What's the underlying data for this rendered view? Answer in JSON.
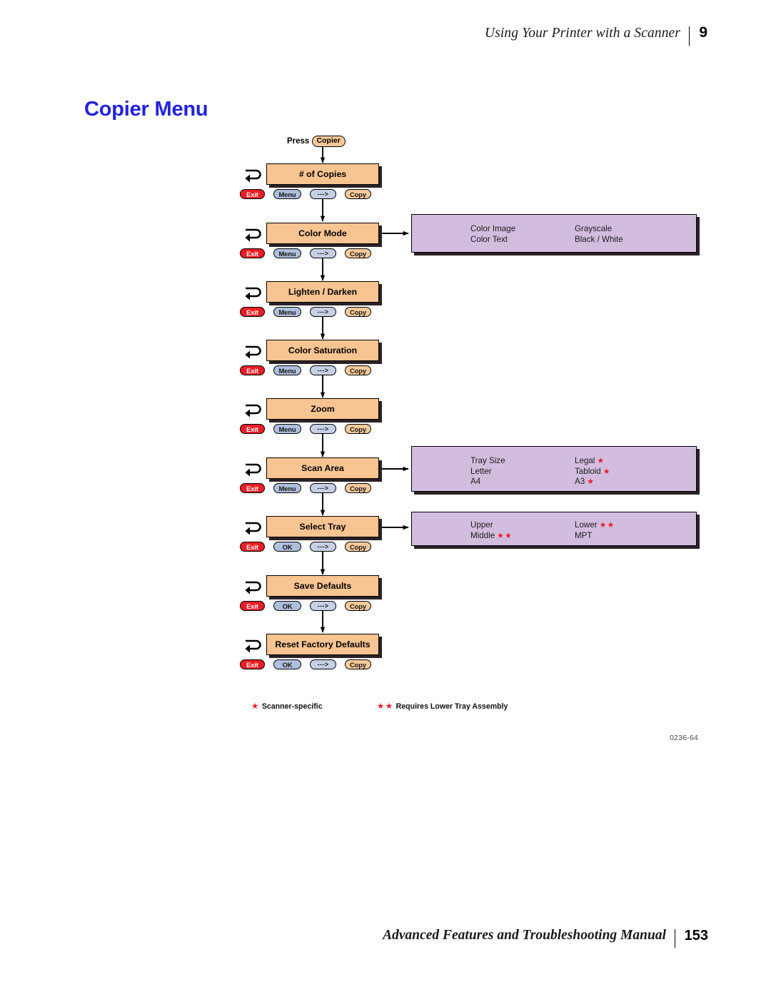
{
  "header": {
    "title": "Using Your Printer with a Scanner",
    "chapter": "9"
  },
  "page_title": "Copier Menu",
  "diagram": {
    "entry_label_prefix": "Press",
    "entry_button": "Copier",
    "figure_id": "0236-64",
    "buttons": {
      "exit": "Exit",
      "menu": "Menu",
      "ok": "OK",
      "arrow": "--->",
      "copy": "Copy"
    },
    "rows": [
      {
        "title": "# of Copies",
        "second_button": "Menu"
      },
      {
        "title": "Color Mode",
        "second_button": "Menu"
      },
      {
        "title": "Lighten / Darken",
        "second_button": "Menu"
      },
      {
        "title": "Color Saturation",
        "second_button": "Menu"
      },
      {
        "title": "Zoom",
        "second_button": "Menu"
      },
      {
        "title": "Scan Area",
        "second_button": "Menu"
      },
      {
        "title": "Select Tray",
        "second_button": "OK"
      },
      {
        "title": "Save Defaults",
        "second_button": "OK"
      },
      {
        "title": "Reset Factory Defaults",
        "second_button": "OK"
      }
    ],
    "panels": [
      {
        "for_row": "Color Mode",
        "left": [
          {
            "text": "Color Image",
            "stars": ""
          },
          {
            "text": "Color Text",
            "stars": ""
          }
        ],
        "right": [
          {
            "text": "Grayscale",
            "stars": ""
          },
          {
            "text": "Black / White",
            "stars": ""
          }
        ]
      },
      {
        "for_row": "Scan Area",
        "left": [
          {
            "text": "Tray Size",
            "stars": ""
          },
          {
            "text": "Letter",
            "stars": ""
          },
          {
            "text": "A4",
            "stars": ""
          }
        ],
        "right": [
          {
            "text": "Legal",
            "stars": "★"
          },
          {
            "text": "Tabloid",
            "stars": "★"
          },
          {
            "text": "A3",
            "stars": "★"
          }
        ]
      },
      {
        "for_row": "Select Tray",
        "left": [
          {
            "text": "Upper",
            "stars": ""
          },
          {
            "text": "Middle",
            "stars": "★★"
          }
        ],
        "right": [
          {
            "text": "Lower",
            "stars": "★★"
          },
          {
            "text": "MPT",
            "stars": ""
          }
        ]
      }
    ],
    "legend": [
      {
        "stars": "★",
        "text": "Scanner-specific"
      },
      {
        "stars": "★★",
        "text": "Requires Lower Tray Assembly"
      }
    ]
  },
  "footer": {
    "title": "Advanced Features and Troubleshooting Manual",
    "page_number": "153"
  },
  "colors": {
    "title_blue": "#2222dd",
    "box_orange": "#f8c491",
    "panel_purple": "#d3bddf",
    "exit_red": "#ed1c24",
    "menu_blue": "#aebfdd",
    "star_red": "#ee1c25"
  }
}
